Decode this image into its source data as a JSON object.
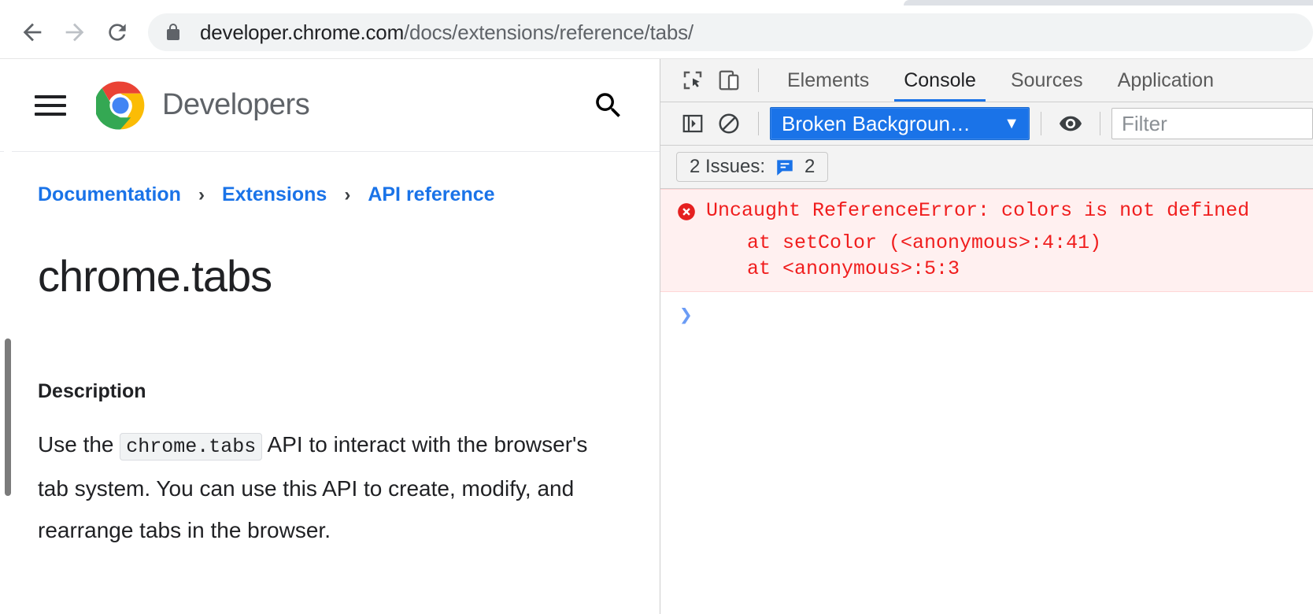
{
  "browser": {
    "back_icon": "arrow-left-icon",
    "forward_icon": "arrow-right-icon",
    "reload_icon": "reload-icon",
    "lock_icon": "lock-icon",
    "url_host": "developer.chrome.com",
    "url_path": "/docs/extensions/reference/tabs/"
  },
  "site": {
    "menu_icon": "hamburger-menu-icon",
    "logo_icon": "chrome-logo-icon",
    "brand": "Developers",
    "search_icon": "search-icon",
    "breadcrumb": [
      {
        "label": "Documentation"
      },
      {
        "label": "Extensions"
      },
      {
        "label": "API reference"
      }
    ],
    "breadcrumb_separator": "›",
    "title": "chrome.tabs",
    "description_heading": "Description",
    "description_pre": "Use the",
    "description_code": "chrome.tabs",
    "description_post": "API to interact with the browser's tab system. You can use this API to create, modify, and rearrange tabs in the browser."
  },
  "devtools": {
    "inspect_icon": "inspect-element-icon",
    "device_toolbar_icon": "device-toolbar-icon",
    "tabs": [
      {
        "label": "Elements",
        "active": false
      },
      {
        "label": "Console",
        "active": true
      },
      {
        "label": "Sources",
        "active": false
      },
      {
        "label": "Application",
        "active": false
      }
    ],
    "console_sidebar_icon": "console-sidebar-icon",
    "clear_console_icon": "clear-console-icon",
    "context_selector": {
      "value": "Broken Backgroun…",
      "caret": "▼",
      "accent_color": "#1a73e8"
    },
    "eye_icon": "eye-icon",
    "filter": {
      "placeholder": "Filter",
      "value": ""
    },
    "issues": {
      "label": "2 Issues:",
      "icon": "issue-message-icon",
      "count": "2"
    },
    "error": {
      "icon": "error-circle-icon",
      "message": "Uncaught ReferenceError: colors is not defined",
      "stack_line_1": "at setColor (<anonymous>:4:41)",
      "stack_line_2": "at <anonymous>:5:3",
      "text_color": "#f01d1d",
      "background_color": "#fff0f0"
    },
    "prompt_caret": "❯"
  }
}
